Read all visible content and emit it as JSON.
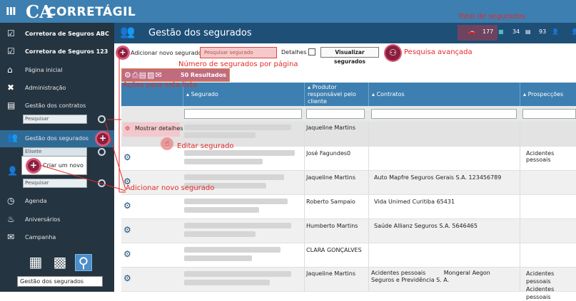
{
  "app": {
    "name": "CORRETÁGIL",
    "logo_mark": "CA",
    "menu_icon": "III"
  },
  "sidebar": {
    "items": [
      {
        "label": "Corretora de Seguros ABC",
        "icon": "check-icon"
      },
      {
        "label": "Corretora de Seguros 123",
        "icon": "check-icon"
      },
      {
        "label": "Página inicial",
        "icon": "home-icon"
      },
      {
        "label": "Administração",
        "icon": "tools-icon"
      },
      {
        "label": "Gestão dos contratos",
        "icon": "contracts-icon"
      },
      {
        "label": "Gestão dos segurados",
        "icon": "users-icon"
      },
      {
        "label": "Agenda",
        "icon": "clock-icon"
      },
      {
        "label": "Aniversários",
        "icon": "cake-icon"
      },
      {
        "label": "Campanha",
        "icon": "campaign-icon"
      }
    ],
    "search1_placeholder": "Pesquisar",
    "search2_value": "Elisete",
    "search3_placeholder": "Pesquisar",
    "popup_label": "Criar um novo",
    "bottom_label": "Gestão dos segurados"
  },
  "header": {
    "title": "Gestão dos segurados",
    "stats": [
      {
        "value": "177"
      },
      {
        "value": "34"
      },
      {
        "value": "93"
      }
    ]
  },
  "toolbar": {
    "add_label": "Adicionar novo segurado",
    "search_placeholder": "Pesquisar segurado",
    "details_label": "Detalhes",
    "view_button": "Visualizar segurados"
  },
  "actions": {
    "results": "50 Resultados"
  },
  "annotations": {
    "total": "Total de segurados",
    "per_page": "Número de segurados por página",
    "advanced": "Pesquisa avançada",
    "actions_list": "Ações para esta lista",
    "edit": "Editar segurado",
    "add_new": "Adicionar novo segurado"
  },
  "table": {
    "columns": [
      "",
      "Segurado",
      "Produtor responsável pelo cliente",
      "Contratos",
      "Prospecções"
    ],
    "show_details": "Mostrar detalhes",
    "rows": [
      {
        "producer": "Jaqueline Martins",
        "contracts": "",
        "prospects": ""
      },
      {
        "producer": "José Fagundes0",
        "contracts": "",
        "prospects": "Acidentes pessoais"
      },
      {
        "producer": "Jaqueline Martins",
        "contracts": "Auto  Mapfre Seguros Gerais S.A.  123456789",
        "prospects": ""
      },
      {
        "producer": "Roberto Sampaio",
        "contracts": "Vida  Unimed Curitiba  65431",
        "prospects": ""
      },
      {
        "producer": "Humberto Martins",
        "contracts": "Saúde  Allianz Seguros S.A.  5646465",
        "prospects": ""
      },
      {
        "producer": "CLARA GONÇALVES",
        "contracts": "",
        "prospects": ""
      },
      {
        "producer": "Jaqueline Martins",
        "contracts": "Acidentes pessoais          Mongeral Aegon Seguros e Previdência S. A.",
        "prospects": "Acidentes pessoais\nAcidentes pessoais"
      }
    ]
  }
}
